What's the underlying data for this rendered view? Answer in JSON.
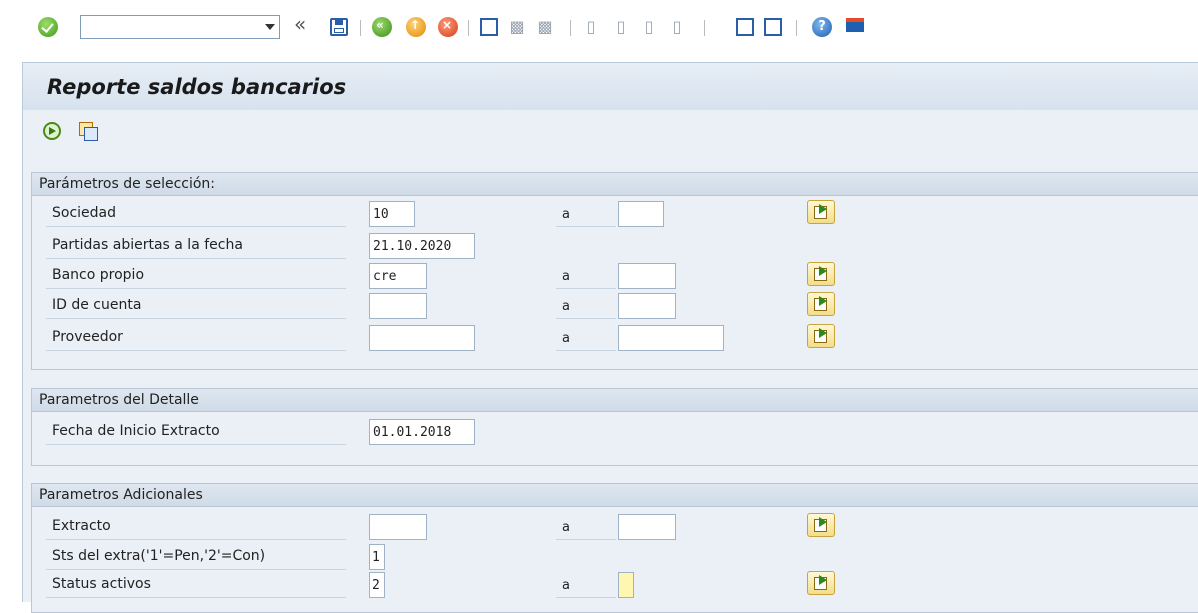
{
  "toolbar": {
    "command_field_value": "",
    "icons": [
      "ok-icon",
      "command-dropdown-icon",
      "collapse-chevron-icon",
      "save-icon",
      "back-icon",
      "exit-icon",
      "cancel-icon",
      "print-icon",
      "find-icon",
      "find-next-icon",
      "first-page-icon",
      "previous-page-icon",
      "next-page-icon",
      "last-page-icon",
      "new-session-icon",
      "shortcut-icon",
      "help-icon",
      "layout-menu-icon"
    ],
    "chevron_glyph": "«",
    "help_glyph": "?"
  },
  "title": "Reporte saldos bancarios",
  "app_toolbar": {
    "icons": [
      "execute-icon",
      "get-variant-icon"
    ]
  },
  "groups": {
    "seleccion": {
      "header": "Parámetros de selección:",
      "sociedad": {
        "label": "Sociedad",
        "from": "10",
        "to_label": "a",
        "to": ""
      },
      "partidas": {
        "label": "Partidas abiertas a la fecha",
        "value": "21.10.2020"
      },
      "banco": {
        "label": "Banco propio",
        "from": "cre",
        "to_label": "a",
        "to": ""
      },
      "cuenta": {
        "label": "ID de cuenta",
        "from": "",
        "to_label": "a",
        "to": ""
      },
      "proveedor": {
        "label": "Proveedor",
        "from": "",
        "to_label": "a",
        "to": ""
      }
    },
    "detalle": {
      "header": "Parametros del Detalle",
      "fecha_inicio": {
        "label": "Fecha de Inicio Extracto",
        "value": "01.01.2018"
      }
    },
    "adicionales": {
      "header": "Parametros Adicionales",
      "extracto": {
        "label": "Extracto",
        "from": "",
        "to_label": "a",
        "to": ""
      },
      "sts_extra": {
        "label": "Sts del extra('1'=Pen,'2'=Con)",
        "value": "1"
      },
      "status_activos": {
        "label": "Status activos",
        "from": "2",
        "to_label": "a",
        "to": ""
      }
    }
  },
  "colors": {
    "background": "#eaf0f6",
    "header": "#d6e2ee",
    "multi_button": "#f3dd8a"
  }
}
